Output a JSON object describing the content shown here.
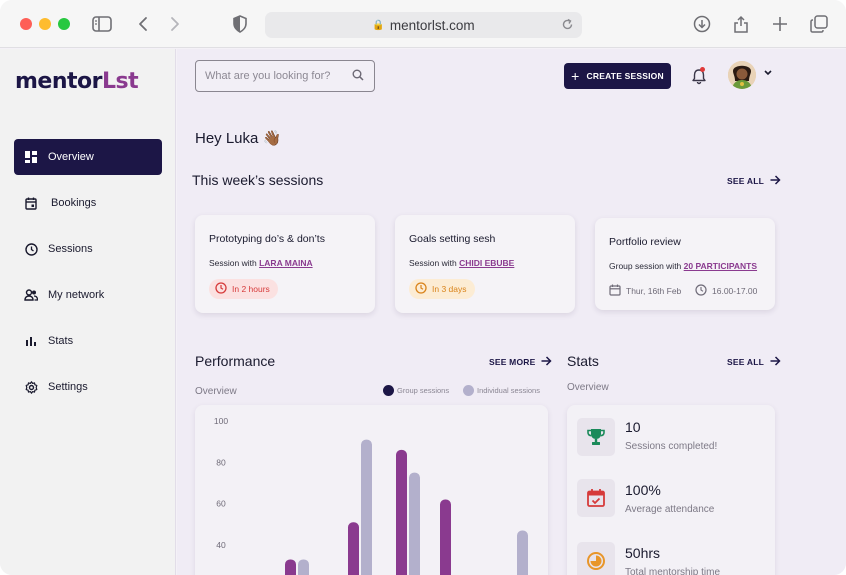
{
  "browser": {
    "url": "mentorlst.com"
  },
  "brand": {
    "logo_main": "mentor",
    "logo_accent": "Lst",
    "colors": {
      "navy": "#1c1646",
      "purple": "#8a3a8f",
      "lavender": "#b3b0cc",
      "red": "#d63a3a",
      "orange": "#d9831a",
      "green": "#1b8a5a"
    }
  },
  "sidebar": {
    "items": [
      {
        "label": "Overview",
        "icon": "dashboard-icon",
        "active": true
      },
      {
        "label": "Bookings",
        "icon": "calendar-icon"
      },
      {
        "label": "Sessions",
        "icon": "clock-icon"
      },
      {
        "label": "My network",
        "icon": "people-icon"
      },
      {
        "label": "Stats",
        "icon": "bar-chart-icon"
      },
      {
        "label": "Settings",
        "icon": "gear-icon"
      }
    ]
  },
  "header": {
    "search_placeholder": "What are you looking for?",
    "create_label": "CREATE SESSION"
  },
  "greeting": "Hey Luka 👋🏾",
  "sessions": {
    "title": "This week’s sessions",
    "see_all": "SEE ALL",
    "cards": [
      {
        "title": "Prototyping do’s & don’ts",
        "sub_prefix": "Session with",
        "with": "LARA MAINA",
        "badge": "In 2 hours",
        "badge_color": "red"
      },
      {
        "title": "Goals setting sesh",
        "sub_prefix": "Session with",
        "with": "CHIDI EBUBE",
        "badge": "In 3 days",
        "badge_color": "orange"
      },
      {
        "title": "Portfolio review",
        "sub_prefix": "Group session with",
        "with": "20 PARTICIPANTS",
        "date": "Thur, 16th Feb",
        "time": "16.00-17.00"
      }
    ]
  },
  "performance": {
    "title": "Performance",
    "see_more": "SEE MORE",
    "overview_label": "Overview",
    "legend": [
      "Group sessions",
      "Individual sessions"
    ]
  },
  "chart_data": {
    "type": "bar",
    "series": [
      {
        "name": "Group sessions",
        "values": [
          33,
          51,
          86,
          62,
          null
        ]
      },
      {
        "name": "Individual sessions",
        "values": [
          33,
          91,
          75,
          null,
          47
        ]
      }
    ],
    "y_ticks": [
      100,
      80,
      60,
      40
    ],
    "ylim": [
      0,
      100
    ],
    "grid": false
  },
  "stats": {
    "title": "Stats",
    "see_all": "SEE ALL",
    "overview_label": "Overview",
    "items": [
      {
        "value": "10",
        "label": "Sessions completed!",
        "icon": "trophy-icon",
        "color": "#1b8a5a"
      },
      {
        "value": "100%",
        "label": "Average attendance",
        "icon": "calendar-check-icon",
        "color": "#d63a3a"
      },
      {
        "value": "50hrs",
        "label": "Total mentorship time",
        "icon": "timer-icon",
        "color": "#e8962a"
      }
    ]
  }
}
